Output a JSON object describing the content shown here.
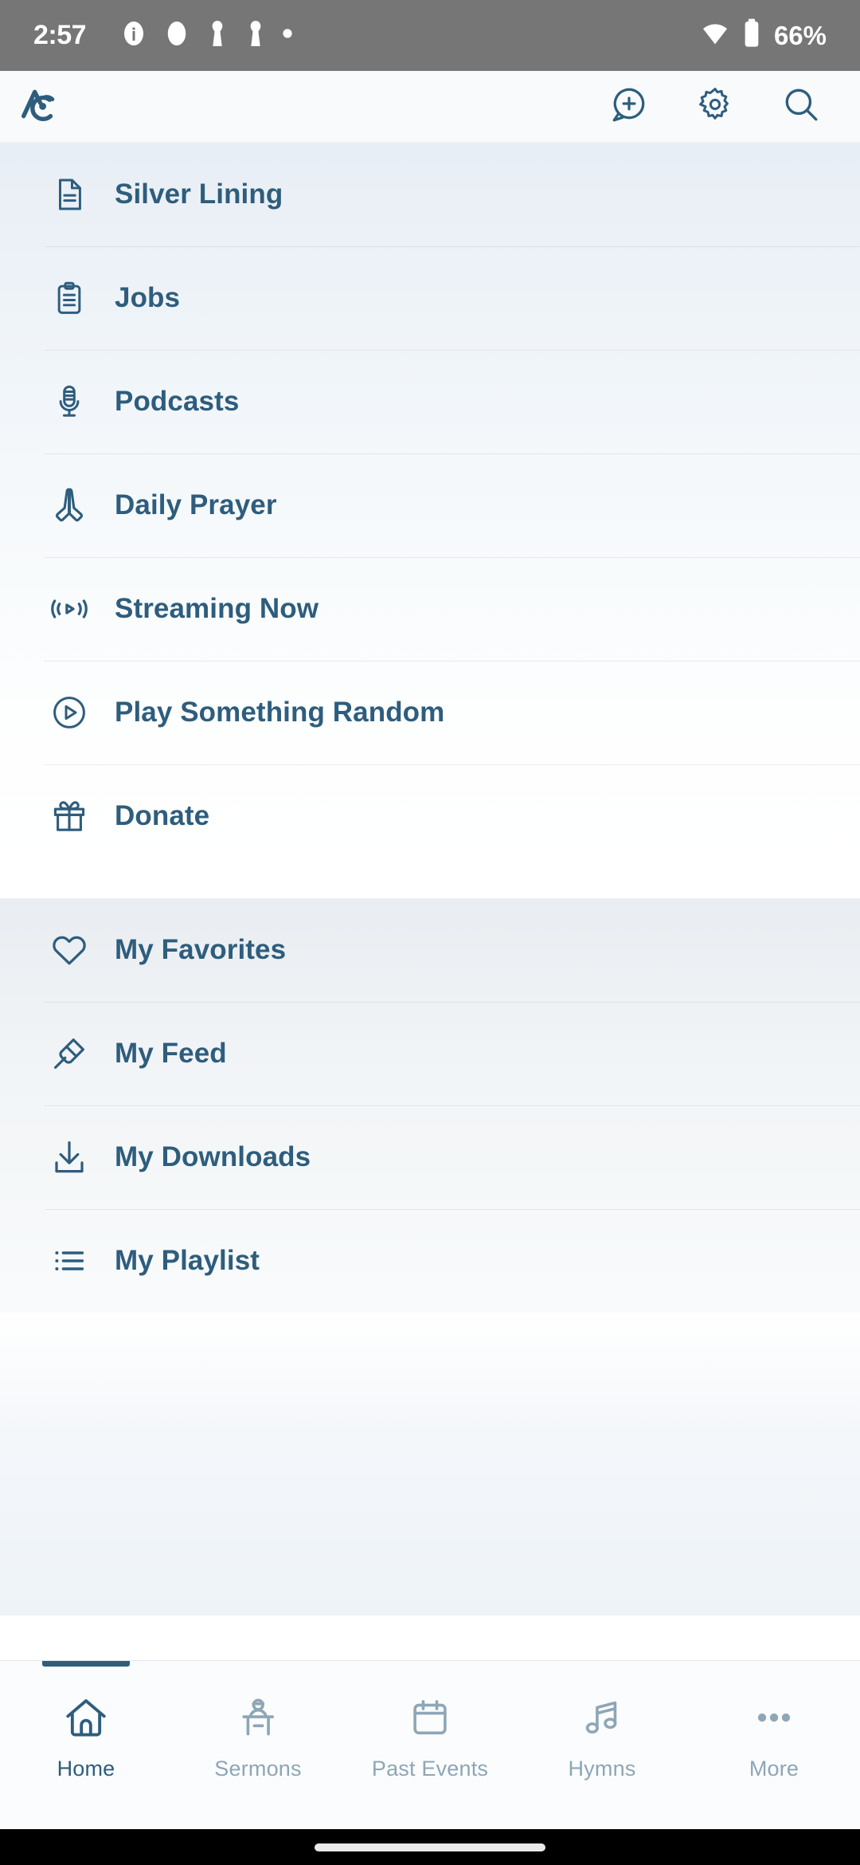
{
  "status_bar": {
    "time": "2:57",
    "battery_percent": "66%",
    "icons": [
      "info-icon",
      "circle-icon",
      "notification-icon",
      "notification-icon",
      "dot-icon"
    ],
    "right_icons": [
      "wifi-icon",
      "battery-icon"
    ],
    "background_color": "#767676"
  },
  "app_bar": {
    "logo": "sermonaudio-logo",
    "actions": [
      {
        "name": "add-comment-button",
        "icon": "chat-plus-icon"
      },
      {
        "name": "settings-button",
        "icon": "gear-icon"
      },
      {
        "name": "search-button",
        "icon": "search-icon"
      }
    ],
    "background_color": "#f8fafb"
  },
  "theme": {
    "accent": "#2e5d7d",
    "inactive": "#8ea6b6",
    "divider": "#dde5ec"
  },
  "menu": {
    "sections": [
      {
        "id": "discover",
        "items": [
          {
            "label": "Silver Lining",
            "icon": "document-icon"
          },
          {
            "label": "Jobs",
            "icon": "clipboard-icon"
          },
          {
            "label": "Podcasts",
            "icon": "microphone-icon"
          },
          {
            "label": "Daily Prayer",
            "icon": "praying-hands-icon"
          },
          {
            "label": "Streaming Now",
            "icon": "broadcast-icon"
          },
          {
            "label": "Play Something Random",
            "icon": "play-circle-icon"
          },
          {
            "label": "Donate",
            "icon": "gift-icon"
          }
        ]
      },
      {
        "id": "personal",
        "items": [
          {
            "label": "My Favorites",
            "icon": "heart-icon"
          },
          {
            "label": "My Feed",
            "icon": "pin-icon"
          },
          {
            "label": "My Downloads",
            "icon": "download-icon"
          },
          {
            "label": "My Playlist",
            "icon": "list-icon"
          }
        ]
      }
    ]
  },
  "bottom_nav": {
    "tabs": [
      {
        "label": "Home",
        "icon": "home-icon",
        "active": true
      },
      {
        "label": "Sermons",
        "icon": "pulpit-icon",
        "active": false
      },
      {
        "label": "Past Events",
        "icon": "calendar-icon",
        "active": false
      },
      {
        "label": "Hymns",
        "icon": "music-note-icon",
        "active": false
      },
      {
        "label": "More",
        "icon": "ellipsis-icon",
        "active": false
      }
    ]
  }
}
